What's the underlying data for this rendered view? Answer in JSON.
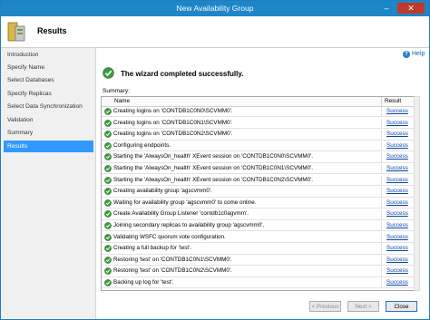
{
  "window": {
    "title": "New Availability Group"
  },
  "header": {
    "title": "Results"
  },
  "help": {
    "label": "Help"
  },
  "sidebar": {
    "items": [
      {
        "label": "Introduction"
      },
      {
        "label": "Specify Name"
      },
      {
        "label": "Select Databases"
      },
      {
        "label": "Specify Replicas"
      },
      {
        "label": "Select Data Synchronization"
      },
      {
        "label": "Validation"
      },
      {
        "label": "Summary"
      },
      {
        "label": "Results",
        "selected": true
      }
    ]
  },
  "main": {
    "banner": "The wizard completed successfully.",
    "summary_label": "Summary:",
    "columns": [
      "Name",
      "Result"
    ],
    "rows": [
      {
        "name": "Creating logins on 'CONTDB1C0N0\\SCVMM0'.",
        "result": "Success"
      },
      {
        "name": "Creating logins on 'CONTDB1C0N1\\SCVMM0'.",
        "result": "Success"
      },
      {
        "name": "Creating logins on 'CONTDB1C0N2\\SCVMM0'.",
        "result": "Success"
      },
      {
        "name": "Configuring endpoints.",
        "result": "Success"
      },
      {
        "name": "Starting the 'AlwaysOn_health' XEvent session on 'CONTDB1C0N0\\SCVMM0'.",
        "result": "Success"
      },
      {
        "name": "Starting the 'AlwaysOn_health' XEvent session on 'CONTDB1C0N1\\SCVMM0'.",
        "result": "Success"
      },
      {
        "name": "Starting the 'AlwaysOn_health' XEvent session on 'CONTDB1C0N2\\SCVMM0'.",
        "result": "Success"
      },
      {
        "name": "Creating availability group 'agscvmm0'.",
        "result": "Success"
      },
      {
        "name": "Waiting for availability group 'agscvmm0' to come online.",
        "result": "Success"
      },
      {
        "name": "Create Availability Group Listener 'contdb1c0agvmm'.",
        "result": "Success"
      },
      {
        "name": "Joining secondary replicas to availability group 'agscvmm0'.",
        "result": "Success"
      },
      {
        "name": "Validating WSFC quorum vote configuration.",
        "result": "Success"
      },
      {
        "name": "Creating a full backup for 'test'.",
        "result": "Success"
      },
      {
        "name": "Restoring 'test' on 'CONTDB1C0N1\\SCVMM0'.",
        "result": "Success"
      },
      {
        "name": "Restoring 'test' on 'CONTDB1C0N2\\SCVMM0'.",
        "result": "Success"
      },
      {
        "name": "Backing up log for 'test'.",
        "result": "Success"
      }
    ]
  },
  "buttons": {
    "previous": "< Previous",
    "next": "Next >",
    "close": "Close"
  },
  "icons": {
    "success": "check-circle-icon"
  },
  "colors": {
    "titlebar": "#1c86c8",
    "selected": "#3399ff",
    "success": "#3c9a3c",
    "link": "#0645ad"
  }
}
